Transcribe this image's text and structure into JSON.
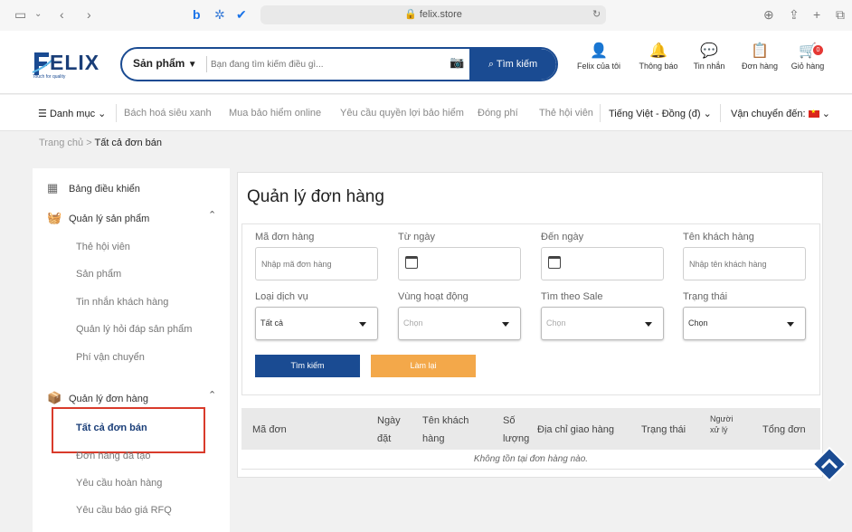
{
  "browser": {
    "url": "felix.store"
  },
  "header": {
    "logo_text": "ELIX",
    "logo_tagline": "Touch for quality",
    "search_category": "Sản phẩm",
    "search_placeholder": "Bạn đang tìm kiếm điều gì...",
    "search_button": "Tìm kiếm",
    "nav": [
      {
        "label": "Felix của tôi",
        "icon": "user-icon"
      },
      {
        "label": "Thông báo",
        "icon": "bell-icon"
      },
      {
        "label": "Tin nhắn",
        "icon": "chat-icon"
      },
      {
        "label": "Đơn hàng",
        "icon": "orders-icon"
      },
      {
        "label": "Giỏ hàng",
        "icon": "cart-icon"
      }
    ],
    "cart_count": "0"
  },
  "menubar": {
    "category": "Danh mục",
    "links": [
      "Bách hoá siêu xanh",
      "Mua bảo hiểm online",
      "Yêu cầu quyền lợi bảo hiểm",
      "Đóng phí",
      "Thẻ hội viên"
    ],
    "language": "Tiếng Việt - Đồng (đ)",
    "shipping": "Vận chuyển đến:"
  },
  "breadcrumb": {
    "home": "Trang chủ",
    "sep": ">",
    "current": "Tất cả đơn bán"
  },
  "sidebar": {
    "dashboard": "Bảng điều khiển",
    "products_group": "Quản lý sản phẩm",
    "products_items": [
      "Thẻ hội viên",
      "Sản phẩm",
      "Tin nhắn khách hàng",
      "Quản lý hỏi đáp sản phẩm",
      "Phí vận chuyển"
    ],
    "orders_group": "Quản lý đơn hàng",
    "orders_items": [
      "Tất cả đơn bán",
      "Đơn hàng đã tạo",
      "Yêu cầu hoàn hàng",
      "Yêu cầu báo giá RFQ"
    ]
  },
  "main": {
    "title": "Quản lý đơn hàng",
    "filters": {
      "order_code_label": "Mã đơn hàng",
      "order_code_placeholder": "Nhập mã đơn hàng",
      "from_date_label": "Từ ngày",
      "to_date_label": "Đến ngày",
      "customer_label": "Tên khách hàng",
      "customer_placeholder": "Nhập tên khách hàng",
      "service_label": "Loại dịch vụ",
      "service_value": "Tất cả",
      "region_label": "Vùng hoạt động",
      "region_value": "Chọn",
      "sale_label": "Tìm theo Sale",
      "sale_value": "Chọn",
      "status_label": "Trạng thái",
      "status_value": "Chọn"
    },
    "search_button": "Tìm kiếm",
    "reset_button": "Làm lại",
    "table": {
      "headers": {
        "order_code": "Mã đơn",
        "date_line1": "Ngày",
        "date_line2": "đặt",
        "customer_line1": "Tên khách",
        "customer_line2": "hàng",
        "qty_line1": "Số",
        "qty_line2": "lượng",
        "address": "Địa chỉ giao hàng",
        "status": "Trạng thái",
        "handler_line1": "Người",
        "handler_line2": "xử lý",
        "total": "Tổng đơn"
      },
      "empty_message": "Không tồn tại đơn hàng nào."
    }
  },
  "colors": {
    "primary": "#1a4b92",
    "accent": "#f3a84a",
    "highlight": "#d93b2b"
  }
}
